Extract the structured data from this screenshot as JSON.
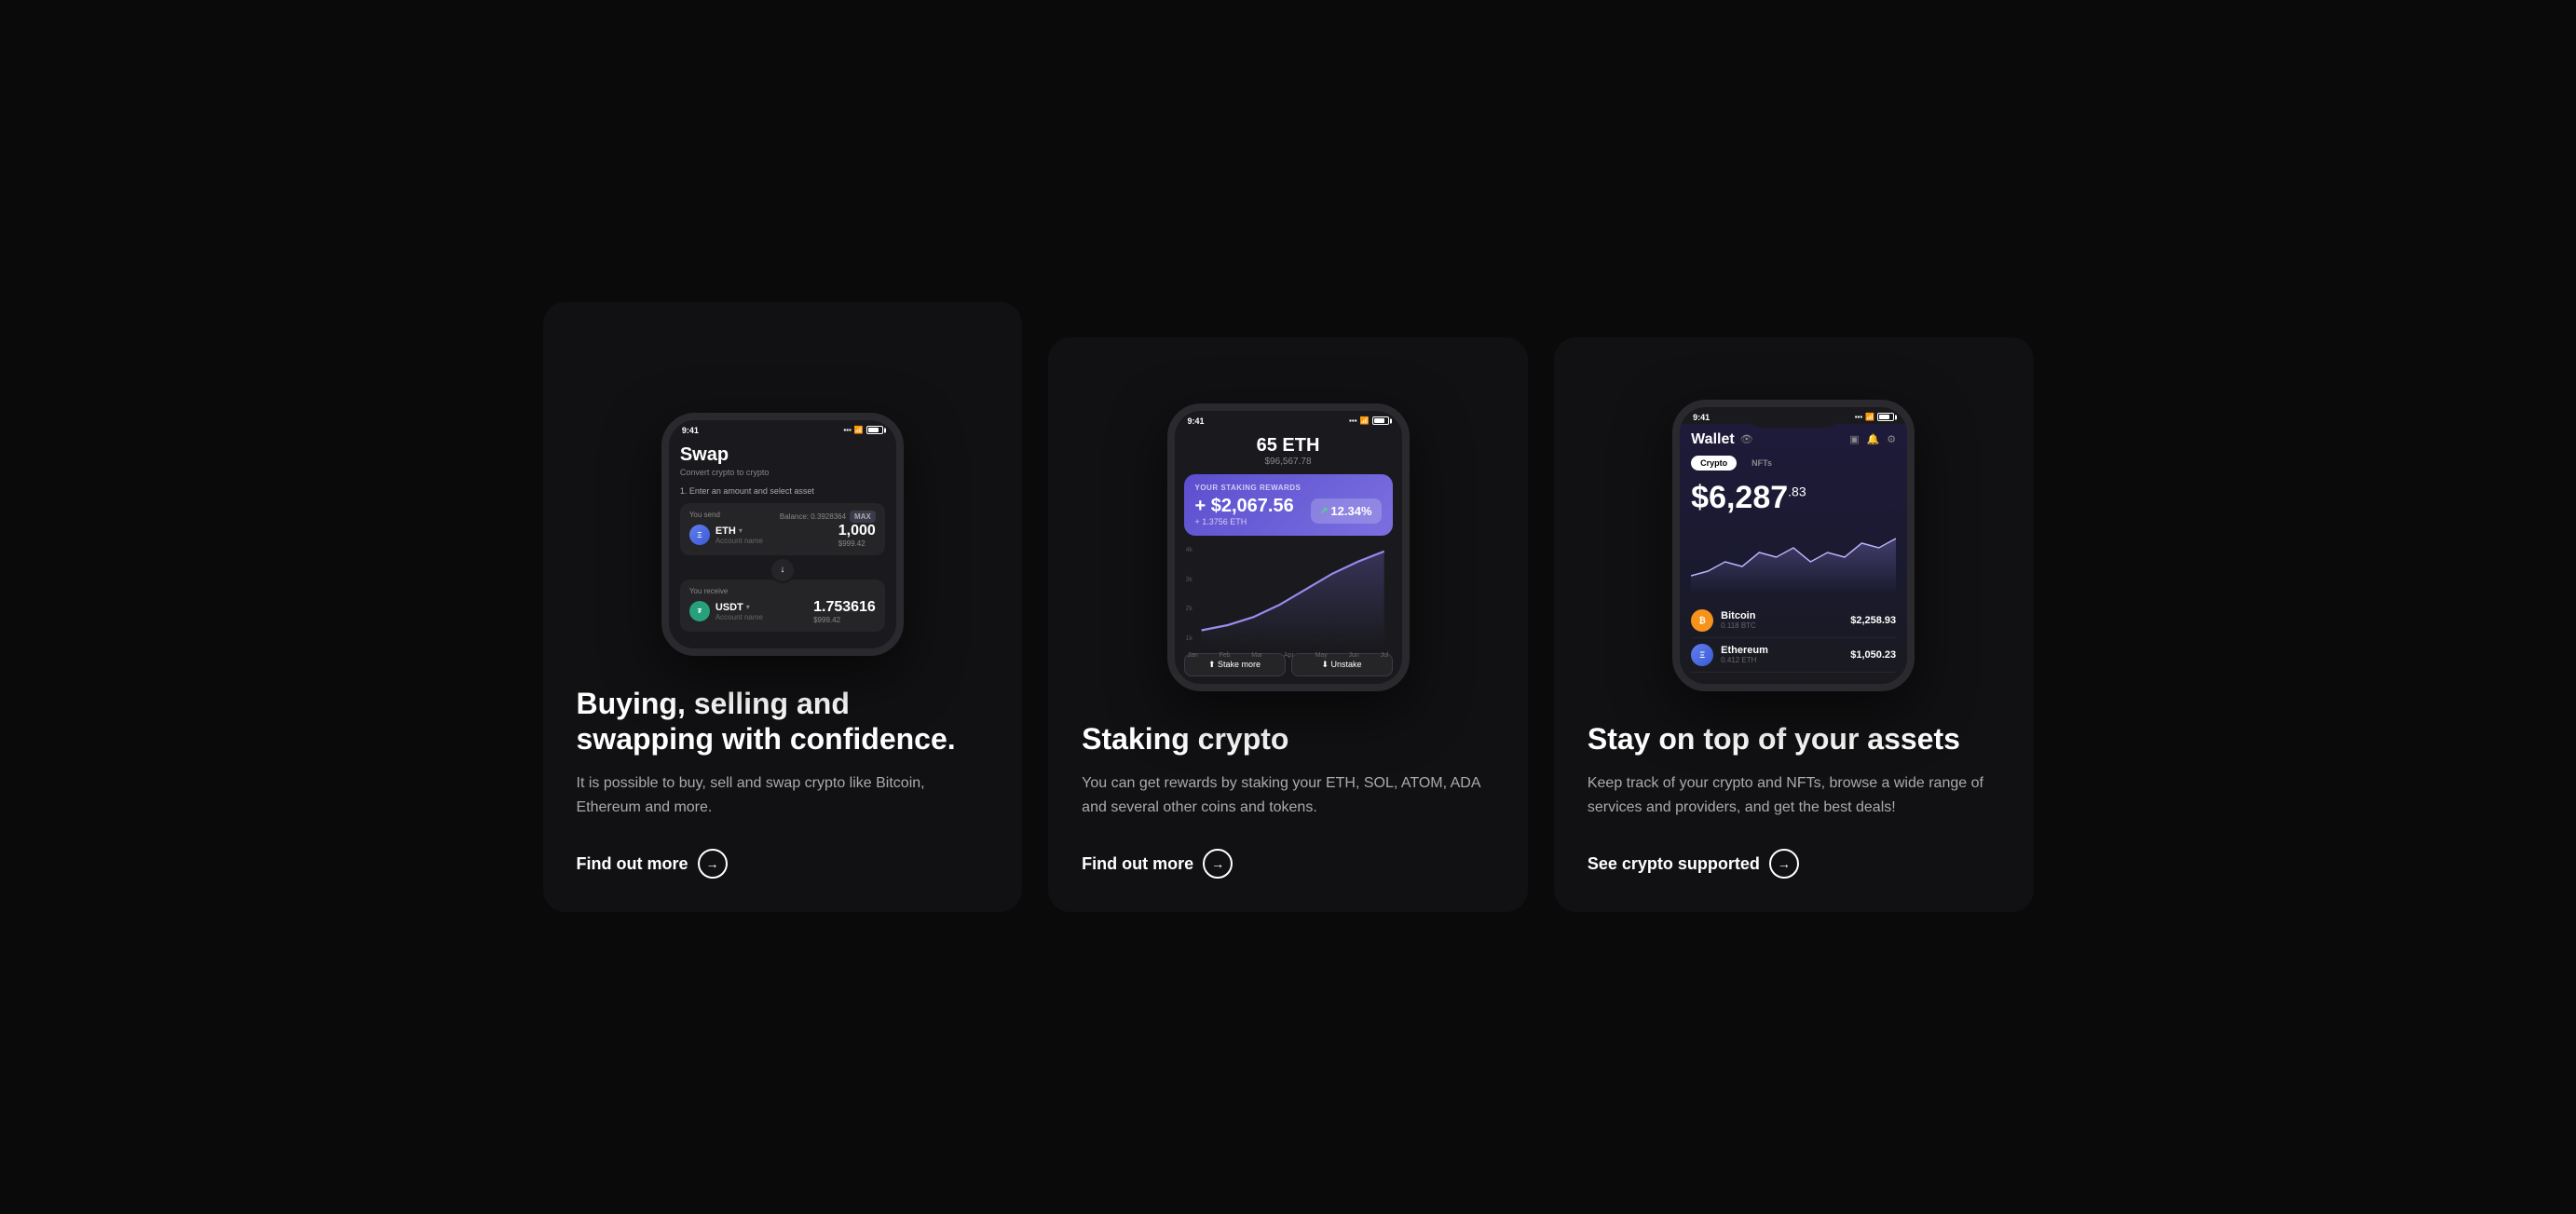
{
  "cards": [
    {
      "id": "swap",
      "phone": {
        "time": "9:41",
        "title": "Swap",
        "subtitle": "Convert crypto to crypto",
        "step": "1. Enter an amount and select asset",
        "send_label": "You send",
        "balance": "Balance: 0.3928364",
        "max": "MAX",
        "send_token": "ETH",
        "send_token_sub": "Account name",
        "send_amount": "1,000",
        "send_usd": "$999.42",
        "receive_label": "You receive",
        "receive_token": "USDT",
        "receive_token_sub": "Account name",
        "receive_amount": "1.753616",
        "receive_usd": "$999.42"
      },
      "heading": "Buying, selling and swapping with confidence.",
      "body": "It is possible to buy, sell and swap crypto like Bitcoin, Ethereum and more.",
      "link": "Find out more"
    },
    {
      "id": "staking",
      "phone": {
        "time": "9:41",
        "eth_amount": "65 ETH",
        "eth_usd": "$96,567.78",
        "rewards_label": "YOUR STAKING REWARDS",
        "rewards_amount": "+ $2,067.56",
        "rewards_eth": "+ 1.3756 ETH",
        "rewards_percent": "12.34%",
        "chart_y": [
          "4k",
          "3k",
          "2k",
          "1k"
        ],
        "chart_x": [
          "Jan",
          "Feb",
          "Mar",
          "Apr",
          "May",
          "Jun",
          "Jul"
        ],
        "btn_stake": "Stake more",
        "btn_unstake": "Unstake"
      },
      "heading": "Staking crypto",
      "body": "You can get rewards by staking your ETH, SOL, ATOM, ADA and several other coins and tokens.",
      "link": "Find out more"
    },
    {
      "id": "wallet",
      "phone": {
        "time": "9:41",
        "title": "Wallet",
        "tab_crypto": "Crypto",
        "tab_nfts": "NFTs",
        "balance_main": "$6,287",
        "balance_cents": ".83",
        "assets": [
          {
            "name": "Bitcoin",
            "sub": "0.118 BTC",
            "value": "$2,258.93",
            "icon": "BTC"
          },
          {
            "name": "Ethereum",
            "sub": "0.412 ETH",
            "value": "$1,050.23",
            "icon": "ETH"
          }
        ]
      },
      "heading": "Stay on top of your assets",
      "body": "Keep track of your crypto and NFTs, browse a wide range of services and providers, and get the best deals!",
      "link": "See crypto supported"
    }
  ]
}
